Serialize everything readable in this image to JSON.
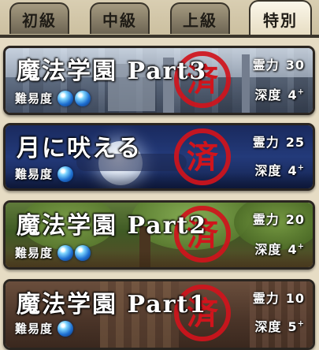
{
  "tabs": [
    {
      "label": "初級",
      "active": false
    },
    {
      "label": "中級",
      "active": false
    },
    {
      "label": "上級",
      "active": false
    },
    {
      "label": "特別",
      "active": true
    }
  ],
  "cards": [
    {
      "title": "魔法学園 Part3",
      "difficulty_label": "難易度",
      "difficulty": 2,
      "power_label": "霊力",
      "power": "30",
      "depth_label": "深度",
      "depth": "4",
      "depth_suffix": "+",
      "cleared_mark": "済"
    },
    {
      "title": "月に吠える",
      "difficulty_label": "難易度",
      "difficulty": 1,
      "power_label": "霊力",
      "power": "25",
      "depth_label": "深度",
      "depth": "4",
      "depth_suffix": "+",
      "cleared_mark": "済"
    },
    {
      "title": "魔法学園 Part2",
      "difficulty_label": "難易度",
      "difficulty": 2,
      "power_label": "霊力",
      "power": "20",
      "depth_label": "深度",
      "depth": "4",
      "depth_suffix": "+",
      "cleared_mark": "済"
    },
    {
      "title": "魔法学園 Part1",
      "difficulty_label": "難易度",
      "difficulty": 1,
      "power_label": "霊力",
      "power": "10",
      "depth_label": "深度",
      "depth": "5",
      "depth_suffix": "+",
      "cleared_mark": "済"
    }
  ],
  "colors": {
    "stamp_red": "#d0141c",
    "orb_blue": "#1e6fd0"
  }
}
